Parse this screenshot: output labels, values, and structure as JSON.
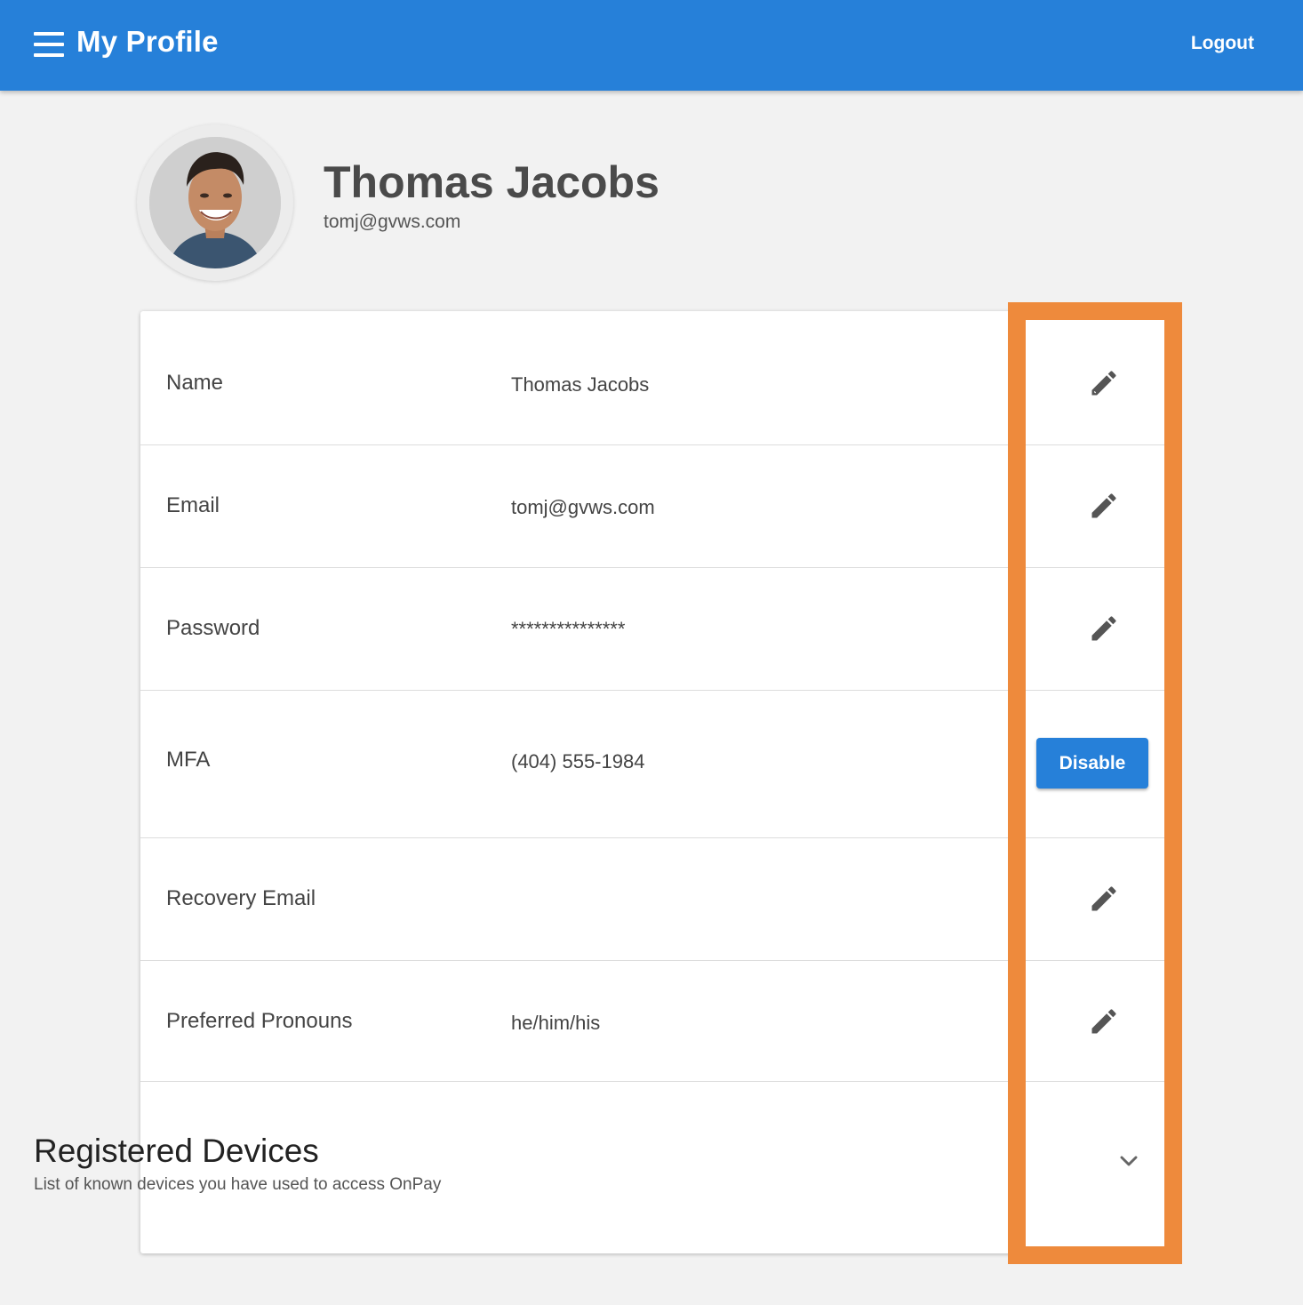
{
  "header": {
    "title": "My Profile",
    "logout_label": "Logout",
    "menu_icon": "hamburger-menu-icon"
  },
  "profile": {
    "name": "Thomas Jacobs",
    "email": "tomj@gvws.com"
  },
  "rows": [
    {
      "label": "Name",
      "value": "Thomas Jacobs",
      "action": "edit"
    },
    {
      "label": "Email",
      "value": "tomj@gvws.com",
      "action": "edit"
    },
    {
      "label": "Password",
      "value": "***************",
      "action": "edit"
    },
    {
      "label": "MFA",
      "value": "(404) 555-1984",
      "action": "Disable"
    },
    {
      "label": "Recovery Email",
      "value": "",
      "action": "edit"
    },
    {
      "label": "Preferred Pronouns",
      "value": "he/him/his",
      "action": "edit"
    }
  ],
  "devices": {
    "title": "Registered Devices",
    "subtitle": "List of known devices you have used to access OnPay"
  },
  "colors": {
    "primary": "#2680d9",
    "highlight": "#ee8a3c",
    "background": "#f2f2f2"
  }
}
